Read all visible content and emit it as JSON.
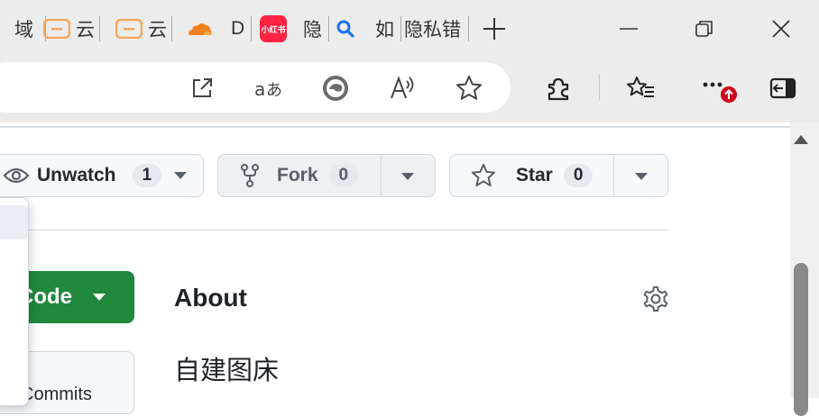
{
  "tabs": [
    {
      "label": "域",
      "icon": "page-icon"
    },
    {
      "label": "云",
      "icon": "bracket-icon"
    },
    {
      "label": "云",
      "icon": "bracket-icon"
    },
    {
      "label": "D",
      "icon": "cloudflare-icon"
    },
    {
      "label": "隐",
      "icon": "xiaohongshu-icon",
      "icon_text": "小红书"
    },
    {
      "label": "如",
      "icon": "search-icon"
    },
    {
      "label": "隐私错",
      "icon": ""
    }
  ],
  "new_tab": "+",
  "colors": {
    "accent_orange": "#f5a65b",
    "cloudflare": "#f48120",
    "xhs_red": "#ff2442",
    "search_blue": "#1a73e8",
    "code_green": "#1f883d",
    "badge_red": "#d0021b"
  },
  "repo_actions": {
    "unwatch_label": "Unwatch",
    "unwatch_count": "1",
    "fork_label": "Fork",
    "fork_count": "0",
    "star_label": "Star",
    "star_count": "0"
  },
  "code_button": {
    "label": "Code"
  },
  "commits": {
    "label": "Commits"
  },
  "about": {
    "title": "About",
    "description": "自建图床"
  }
}
